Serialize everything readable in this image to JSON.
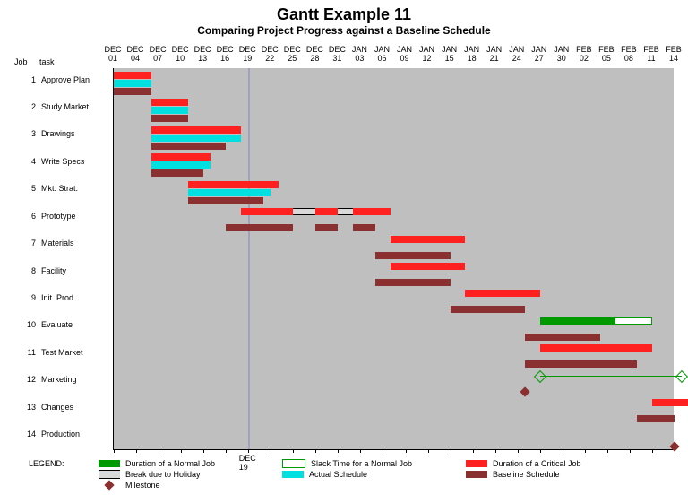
{
  "title": "Gantt Example 11",
  "subtitle": "Comparing Project Progress against a Baseline Schedule",
  "headers": {
    "job": "Job",
    "task": "task"
  },
  "rows": [
    {
      "n": 1,
      "name": "Approve Plan"
    },
    {
      "n": 2,
      "name": "Study Market"
    },
    {
      "n": 3,
      "name": "Drawings"
    },
    {
      "n": 4,
      "name": "Write Specs"
    },
    {
      "n": 5,
      "name": "Mkt. Strat."
    },
    {
      "n": 6,
      "name": "Prototype"
    },
    {
      "n": 7,
      "name": "Materials"
    },
    {
      "n": 8,
      "name": "Facility"
    },
    {
      "n": 9,
      "name": "Init. Prod."
    },
    {
      "n": 10,
      "name": "Evaluate"
    },
    {
      "n": 11,
      "name": "Test Market"
    },
    {
      "n": 12,
      "name": "Marketing"
    },
    {
      "n": 13,
      "name": "Changes"
    },
    {
      "n": 14,
      "name": "Production"
    }
  ],
  "date_ticks": [
    "DEC 01",
    "DEC 04",
    "DEC 07",
    "DEC 10",
    "DEC 13",
    "DEC 16",
    "DEC 19",
    "DEC 22",
    "DEC 25",
    "DEC 28",
    "DEC 31",
    "JAN 03",
    "JAN 06",
    "JAN 09",
    "JAN 12",
    "JAN 15",
    "JAN 18",
    "JAN 21",
    "JAN 24",
    "JAN 27",
    "JAN 30",
    "FEB 02",
    "FEB 05",
    "FEB 08",
    "FEB 11",
    "FEB 14"
  ],
  "x_range_days": 75,
  "now_day": 18,
  "now_label": "DEC 19",
  "legend": {
    "header": "LEGEND:",
    "items": [
      {
        "swatch": "normal",
        "label": "Duration of a Normal Job"
      },
      {
        "swatch": "slack",
        "label": "Slack Time for a Normal Job"
      },
      {
        "swatch": "critical",
        "label": "Duration of a Critical Job"
      },
      {
        "swatch": "holiday",
        "label": "Break due to Holiday"
      },
      {
        "swatch": "actual",
        "label": "Actual Schedule"
      },
      {
        "swatch": "baseline",
        "label": "Baseline Schedule"
      },
      {
        "swatch": "milestone",
        "label": "Milestone"
      }
    ]
  },
  "chart_data": {
    "type": "gantt",
    "x_unit": "days from DEC 01",
    "tasks": [
      {
        "row": 1,
        "bars": [
          {
            "type": "critical",
            "start": 0,
            "end": 5
          },
          {
            "type": "actual",
            "start": 0,
            "end": 5
          },
          {
            "type": "baseline",
            "start": 0,
            "end": 5
          }
        ]
      },
      {
        "row": 2,
        "bars": [
          {
            "type": "critical",
            "start": 5,
            "end": 10
          },
          {
            "type": "actual",
            "start": 5,
            "end": 10
          },
          {
            "type": "baseline",
            "start": 5,
            "end": 10
          }
        ]
      },
      {
        "row": 3,
        "bars": [
          {
            "type": "critical",
            "start": 5,
            "end": 17
          },
          {
            "type": "actual",
            "start": 5,
            "end": 17
          },
          {
            "type": "baseline",
            "start": 5,
            "end": 15
          }
        ]
      },
      {
        "row": 4,
        "bars": [
          {
            "type": "critical",
            "start": 5,
            "end": 13
          },
          {
            "type": "actual",
            "start": 5,
            "end": 13
          },
          {
            "type": "baseline",
            "start": 5,
            "end": 12
          }
        ]
      },
      {
        "row": 5,
        "bars": [
          {
            "type": "critical",
            "start": 10,
            "end": 22
          },
          {
            "type": "actual",
            "start": 10,
            "end": 21
          },
          {
            "type": "baseline",
            "start": 10,
            "end": 20
          }
        ]
      },
      {
        "row": 6,
        "bars": [
          {
            "type": "critical",
            "start": 17,
            "end": 24
          },
          {
            "type": "holiday",
            "start": 24,
            "end": 27
          },
          {
            "type": "critical",
            "start": 27,
            "end": 30
          },
          {
            "type": "holiday",
            "start": 30,
            "end": 32
          },
          {
            "type": "critical",
            "start": 32,
            "end": 37
          },
          {
            "type": "baseline",
            "start": 15,
            "end": 24
          },
          {
            "type": "baseline",
            "start": 27,
            "end": 30
          },
          {
            "type": "baseline",
            "start": 32,
            "end": 35
          }
        ]
      },
      {
        "row": 7,
        "bars": [
          {
            "type": "critical",
            "start": 37,
            "end": 47
          },
          {
            "type": "baseline",
            "start": 35,
            "end": 45
          }
        ]
      },
      {
        "row": 8,
        "bars": [
          {
            "type": "critical",
            "start": 37,
            "end": 47
          },
          {
            "type": "baseline",
            "start": 35,
            "end": 45
          }
        ]
      },
      {
        "row": 9,
        "bars": [
          {
            "type": "critical",
            "start": 47,
            "end": 57
          },
          {
            "type": "baseline",
            "start": 45,
            "end": 55
          }
        ]
      },
      {
        "row": 10,
        "bars": [
          {
            "type": "normal",
            "start": 57,
            "end": 67
          },
          {
            "type": "slack",
            "start": 67,
            "end": 72
          },
          {
            "type": "baseline",
            "start": 55,
            "end": 65
          }
        ]
      },
      {
        "row": 11,
        "bars": [
          {
            "type": "critical",
            "start": 57,
            "end": 72
          },
          {
            "type": "baseline",
            "start": 55,
            "end": 70
          }
        ]
      },
      {
        "row": 12,
        "bars": [
          {
            "type": "marketing_span",
            "start": 57,
            "end": 76
          }
        ],
        "milestones": [
          {
            "day": 55
          }
        ]
      },
      {
        "row": 13,
        "bars": [
          {
            "type": "critical",
            "start": 72,
            "end": 77
          },
          {
            "type": "baseline",
            "start": 70,
            "end": 75
          }
        ]
      },
      {
        "row": 14,
        "bars": [],
        "milestones": [
          {
            "day": 75
          }
        ]
      }
    ]
  }
}
